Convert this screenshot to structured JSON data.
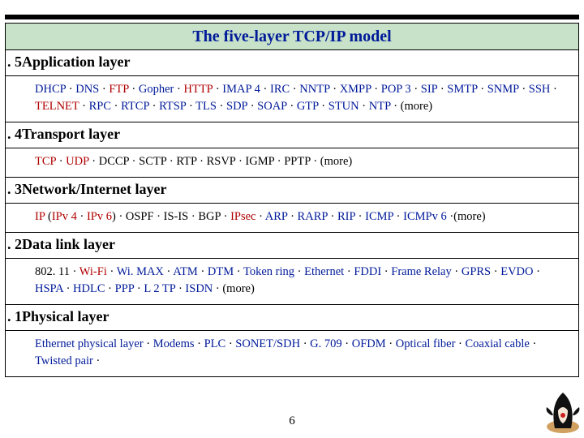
{
  "title": "The five-layer TCP/IP model",
  "layers": [
    {
      "num": ". 5",
      "name": "Application layer",
      "items": [
        {
          "t": "DHCP",
          "c": "blue"
        },
        {
          "t": " · "
        },
        {
          "t": "DNS",
          "c": "blue"
        },
        {
          "t": " · "
        },
        {
          "t": "FTP",
          "c": "red"
        },
        {
          "t": " · "
        },
        {
          "t": "Gopher",
          "c": "blue"
        },
        {
          "t": " · "
        },
        {
          "t": "HTTP",
          "c": "red"
        },
        {
          "t": " · "
        },
        {
          "t": "IMAP 4",
          "c": "blue"
        },
        {
          "t": " · "
        },
        {
          "t": "IRC",
          "c": "blue"
        },
        {
          "t": " · "
        },
        {
          "t": "NNTP",
          "c": "blue"
        },
        {
          "t": " · "
        },
        {
          "t": "XMPP",
          "c": "blue"
        },
        {
          "t": " · "
        },
        {
          "t": "POP 3",
          "c": "blue"
        },
        {
          "t": " · "
        },
        {
          "t": "SIP",
          "c": "blue"
        },
        {
          "t": " · "
        },
        {
          "t": "SMTP",
          "c": "blue"
        },
        {
          "t": " · "
        },
        {
          "t": "SNMP",
          "c": "blue"
        },
        {
          "t": " · "
        },
        {
          "t": "SSH",
          "c": "blue"
        },
        {
          "t": " · "
        },
        {
          "t": "TELNET",
          "c": "red"
        },
        {
          "t": " · "
        },
        {
          "t": "RPC",
          "c": "blue"
        },
        {
          "t": " · "
        },
        {
          "t": "RTCP",
          "c": "blue"
        },
        {
          "t": " · "
        },
        {
          "t": "RTSP",
          "c": "blue"
        },
        {
          "t": " · "
        },
        {
          "t": "TLS",
          "c": "blue"
        },
        {
          "t": " · "
        },
        {
          "t": "SDP",
          "c": "blue"
        },
        {
          "t": " · "
        },
        {
          "t": "SOAP",
          "c": "blue"
        },
        {
          "t": " · "
        },
        {
          "t": "GTP",
          "c": "blue"
        },
        {
          "t": " · "
        },
        {
          "t": "STUN",
          "c": "blue"
        },
        {
          "t": " · "
        },
        {
          "t": "NTP",
          "c": "blue"
        },
        {
          "t": " · (more)"
        }
      ]
    },
    {
      "num": ". 4",
      "name": "Transport layer",
      "items": [
        {
          "t": "TCP",
          "c": "red"
        },
        {
          "t": " · "
        },
        {
          "t": "UDP",
          "c": "red"
        },
        {
          "t": " · DCCP · SCTP · RTP · RSVP · IGMP · PPTP · (more)"
        }
      ]
    },
    {
      "num": ". 3",
      "name": "Network/Internet layer",
      "items": [
        {
          "t": "IP",
          "c": "red"
        },
        {
          "t": " ("
        },
        {
          "t": "IPv 4",
          "c": "red"
        },
        {
          "t": " · "
        },
        {
          "t": "IPv 6",
          "c": "red"
        },
        {
          "t": ") · OSPF · IS-IS · BGP · "
        },
        {
          "t": "IPsec",
          "c": "red"
        },
        {
          "t": " · "
        },
        {
          "t": "ARP",
          "c": "blue"
        },
        {
          "t": " · "
        },
        {
          "t": "RARP",
          "c": "blue"
        },
        {
          "t": " · "
        },
        {
          "t": "RIP",
          "c": "blue"
        },
        {
          "t": " · "
        },
        {
          "t": "ICMP",
          "c": "blue"
        },
        {
          "t": " · "
        },
        {
          "t": "ICMPv 6",
          "c": "blue"
        },
        {
          "t": " ·(more)"
        }
      ]
    },
    {
      "num": ". 2",
      "name": "Data link layer",
      "items": [
        {
          "t": "802. 11"
        },
        {
          "t": " · "
        },
        {
          "t": "Wi-Fi",
          "c": "red"
        },
        {
          "t": " · "
        },
        {
          "t": "Wi. MAX",
          "c": "blue"
        },
        {
          "t": " · "
        },
        {
          "t": "ATM",
          "c": "blue"
        },
        {
          "t": " · "
        },
        {
          "t": "DTM",
          "c": "blue"
        },
        {
          "t": " · "
        },
        {
          "t": "Token ring",
          "c": "blue"
        },
        {
          "t": " · "
        },
        {
          "t": "Ethernet",
          "c": "blue"
        },
        {
          "t": " · "
        },
        {
          "t": "FDDI",
          "c": "blue"
        },
        {
          "t": " · "
        },
        {
          "t": "Frame Relay",
          "c": "blue"
        },
        {
          "t": " · "
        },
        {
          "t": "GPRS",
          "c": "blue"
        },
        {
          "t": " · "
        },
        {
          "t": "EVDO",
          "c": "blue"
        },
        {
          "t": " · "
        },
        {
          "t": "HSPA",
          "c": "blue"
        },
        {
          "t": " · "
        },
        {
          "t": "HDLC",
          "c": "blue"
        },
        {
          "t": " · "
        },
        {
          "t": "PPP",
          "c": "blue"
        },
        {
          "t": " · "
        },
        {
          "t": "L 2 TP",
          "c": "blue"
        },
        {
          "t": " · "
        },
        {
          "t": "ISDN",
          "c": "blue"
        },
        {
          "t": " · (more)"
        }
      ]
    },
    {
      "num": ". 1",
      "name": "Physical layer",
      "items": [
        {
          "t": "Ethernet physical layer",
          "c": "blue"
        },
        {
          "t": " · "
        },
        {
          "t": "Modems",
          "c": "blue"
        },
        {
          "t": " · "
        },
        {
          "t": "PLC",
          "c": "blue"
        },
        {
          "t": " · "
        },
        {
          "t": "SONET/SDH",
          "c": "blue"
        },
        {
          "t": " · "
        },
        {
          "t": "G. 709",
          "c": "blue"
        },
        {
          "t": " · "
        },
        {
          "t": "OFDM",
          "c": "blue"
        },
        {
          "t": " · "
        },
        {
          "t": "Optical fiber",
          "c": "blue"
        },
        {
          "t": " · "
        },
        {
          "t": "Coaxial cable",
          "c": "blue"
        },
        {
          "t": " · "
        },
        {
          "t": "Twisted pair",
          "c": "blue"
        },
        {
          "t": " ·"
        }
      ]
    }
  ],
  "page_number": "6"
}
